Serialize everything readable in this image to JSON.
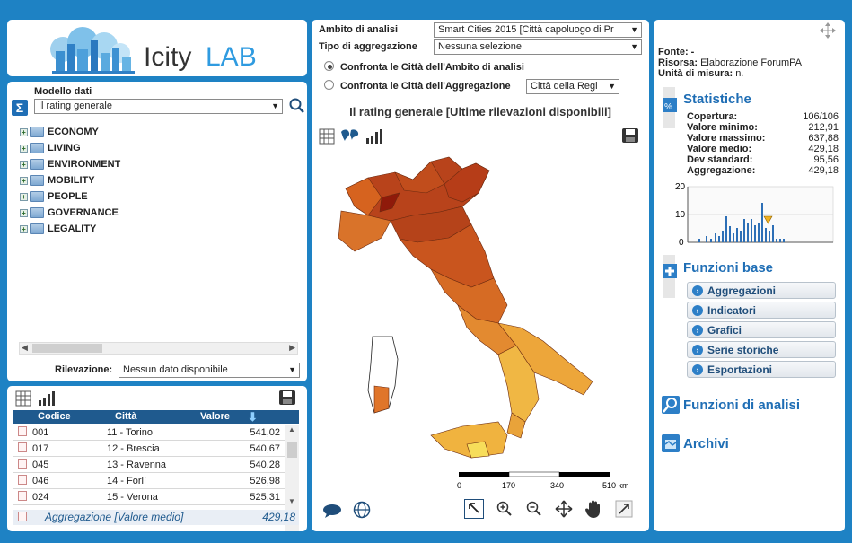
{
  "logo": {
    "text_left": "Icity",
    "text_right": "LAB"
  },
  "model": {
    "label": "Modello dati",
    "select_value": "Il rating generale",
    "tree": [
      "ECONOMY",
      "LIVING",
      "ENVIRONMENT",
      "MOBILITY",
      "PEOPLE",
      "GOVERNANCE",
      "LEGALITY"
    ],
    "rilevazione_label": "Rilevazione:",
    "rilevazione_value": "Nessun dato disponibile"
  },
  "table": {
    "headers": {
      "codice": "Codice",
      "citta": "Città",
      "valore": "Valore"
    },
    "rows": [
      {
        "codice": "001",
        "citta": "11 - Torino",
        "valore": "541,02"
      },
      {
        "codice": "017",
        "citta": "12 - Brescia",
        "valore": "540,67"
      },
      {
        "codice": "045",
        "citta": "13 - Ravenna",
        "valore": "540,28"
      },
      {
        "codice": "046",
        "citta": "14 - Forlì",
        "valore": "526,98"
      },
      {
        "codice": "024",
        "citta": "15 - Verona",
        "valore": "525,31"
      }
    ],
    "footer_label": "Aggregazione [Valore medio]",
    "footer_value": "429,18"
  },
  "center": {
    "ambito_label": "Ambito di analisi",
    "ambito_value": "Smart Cities 2015 [Città capoluogo di Pr",
    "tipo_label": "Tipo di aggregazione",
    "tipo_value": "Nessuna selezione",
    "radio1": "Confronta le Città dell'Ambito di analisi",
    "radio2": "Confronta le Città dell'Aggregazione",
    "radio2_select": "Città della Regi",
    "map_title": "Il rating generale [Ultime rilevazioni disponibili]",
    "scale_labels": [
      "0",
      "170",
      "340",
      "510 km"
    ]
  },
  "right": {
    "fonte": "Fonte: -",
    "risorsa_label": "Risorsa:",
    "risorsa_value": "Elaborazione ForumPA",
    "unita_label": "Unità di misura:",
    "unita_value": "n.",
    "statistiche_title": "Statistiche",
    "stats": [
      {
        "k": "Copertura:",
        "v": "106/106"
      },
      {
        "k": "Valore minimo:",
        "v": "212,91"
      },
      {
        "k": "Valore massimo:",
        "v": "637,88"
      },
      {
        "k": "Valore medio:",
        "v": "429,18"
      },
      {
        "k": "Dev standard:",
        "v": "95,56"
      },
      {
        "k": "Aggregazione:",
        "v": "429,18"
      }
    ],
    "hist_ticks": [
      "20",
      "10",
      "0"
    ],
    "funzioni_base_title": "Funzioni base",
    "buttons": [
      "Aggregazioni",
      "Indicatori",
      "Grafici",
      "Serie storiche",
      "Esportazioni"
    ],
    "funzioni_analisi_title": "Funzioni di analisi",
    "archivi_title": "Archivi"
  },
  "colors": {
    "accent": "#1f6eb5",
    "background": "#1e82c4",
    "header": "#1f5a8e"
  }
}
